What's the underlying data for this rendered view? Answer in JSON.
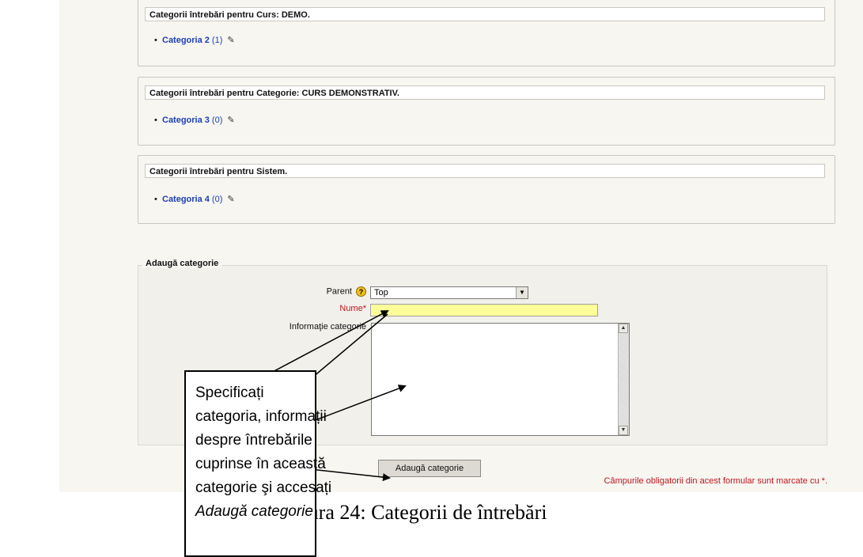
{
  "category_sections": [
    {
      "header": "Categorii întrebări pentru Curs: DEMO.",
      "item_name": "Categoria 2",
      "item_count": "(1)"
    },
    {
      "header": "Categorii întrebări pentru Categorie: CURS DEMONSTRATIV.",
      "item_name": "Categoria 3",
      "item_count": "(0)"
    },
    {
      "header": "Categorii întrebări pentru Sistem.",
      "item_name": "Categoria 4",
      "item_count": "(0)"
    }
  ],
  "form": {
    "legend": "Adaugă categorie",
    "parent_label": "Parent",
    "parent_value": "Top",
    "name_label": "Nume",
    "info_label": "Informaţie categorie",
    "submit_label": "Adaugă categorie",
    "required_note": "Câmpurile obligatorii din acest formular sunt marcate cu",
    "required_marker": "*"
  },
  "caption": "Figura 24: Categorii de întrebări",
  "callout": {
    "lines": [
      "Specificați",
      "categoria, informații",
      "despre întrebările",
      "cuprinse în această",
      "categorie şi accesați"
    ],
    "italic_line": "Adaugă categorie"
  },
  "colors": {
    "link": "#1c3fb8",
    "required": "#c0141b",
    "name_field_bg": "#ffff99"
  }
}
